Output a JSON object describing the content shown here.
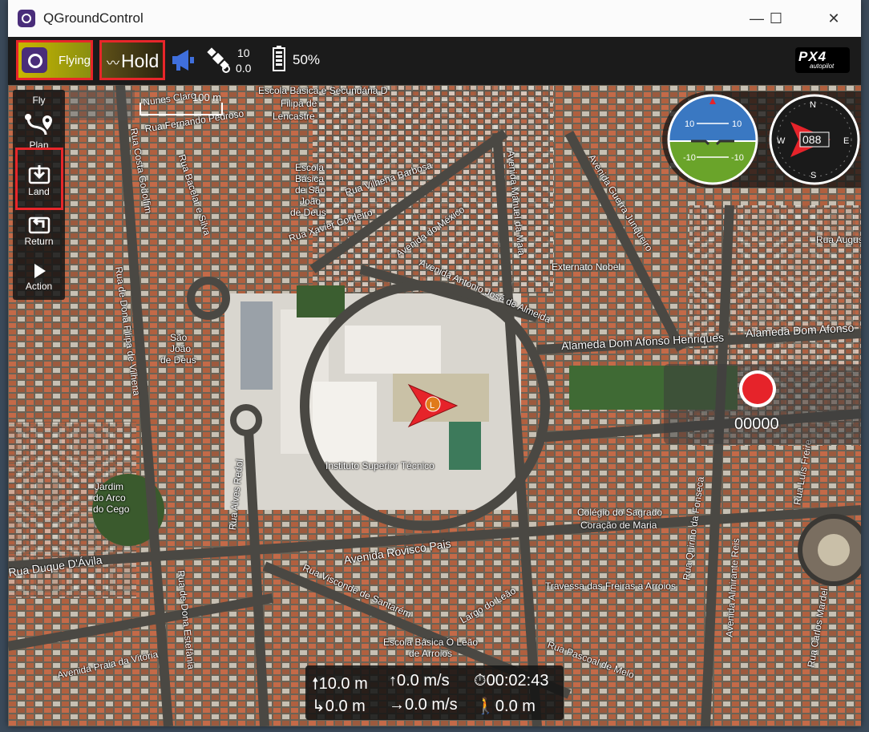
{
  "window": {
    "title": "QGroundControl",
    "controls": [
      "—",
      "☐",
      "✕"
    ]
  },
  "toolbar": {
    "flight_state": "Flying",
    "flight_mode": "Hold",
    "gps_count": "10",
    "gps_hdop": "0.0",
    "battery_percent": "50%",
    "brand": {
      "px4": "PX4",
      "autopilot": "autopilot"
    },
    "mode_color": "#e8262a"
  },
  "plan_tools": [
    {
      "label": "Fly",
      "icon": "fly-icon"
    },
    {
      "label": "Plan",
      "icon": "plan-icon"
    },
    {
      "label": "Land",
      "icon": "land-icon"
    },
    {
      "label": "Return",
      "icon": "return-icon"
    },
    {
      "label": "Action",
      "icon": "action-icon"
    }
  ],
  "map": {
    "scale_label": "100 m",
    "labels": [
      "Nunes Claro",
      "Rua Fernando Pedroso",
      "Escola Básica e Secundária D",
      "Filipa de",
      "Lencastre",
      "Rua Costa Godolfim",
      "Rua Bacelar e Silva",
      "Escola",
      "Básica",
      "de São",
      "João",
      "de Deus",
      "Rua Vilhena Barbosa",
      "Rua Xavier Cordeiro",
      "Avenida do México",
      "Avenida Manuel da Maia",
      "Avenida Guerra Junqueiro",
      "Externato Nobel",
      "Avenida António José de Almeida",
      "Alameda Dom Afonso Henriques",
      "Alameda Dom Afonso",
      "Rua de Dona Filipa de Vilhena",
      "São",
      "João",
      "de Deus",
      "Instituto Superior Técnico",
      "Rua Alves Redol",
      "Jardim",
      "do Arco",
      "do Cego",
      "Colégio do Sagrado",
      "Coração de Maria",
      "Avenida Rovisco Pais",
      "Rua Duque D'Ávila",
      "Rua Visconde de Santarém",
      "Largo do Leão",
      "Escola Básica O Leão",
      "de Arroios",
      "Travessa das Freiras a Arroios",
      "Rua Pascoal de Melo",
      "Avenida Praia da Vitória",
      "Rua de Dona Estefânia",
      "Rua Augusto",
      "Rua Carlos Mardel",
      "Rua Quirino da Fonseca",
      "Avenida Almirante Reis",
      "Rua Luís Freire"
    ],
    "home_marker": "L"
  },
  "instruments": {
    "attitude": {
      "pitch_marks": [
        "10",
        "10",
        "-10",
        "-10"
      ]
    },
    "compass": {
      "heading": "088",
      "cardinals": [
        "N",
        "E",
        "S",
        "W"
      ]
    }
  },
  "camera": {
    "record_time": "00000"
  },
  "telemetry": {
    "altitude": "10.0 m",
    "vertical_speed": "0.0 m/s",
    "flight_time": "00:02:43",
    "distance_to_home": "0.0 m",
    "ground_speed": "0.0 m/s",
    "distance_to_gcs": "0.0 m"
  }
}
